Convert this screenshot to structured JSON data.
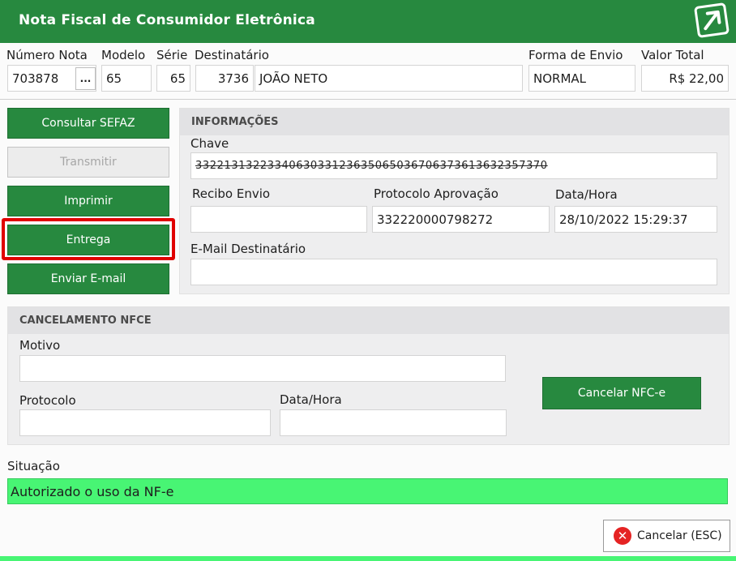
{
  "window": {
    "title": "Nota Fiscal de Consumidor Eletrônica",
    "logo_icon": "external-link-arrow-icon"
  },
  "header_fields": {
    "numero_nota": {
      "label": "Número Nota",
      "value": "703878",
      "lookup_label": "..."
    },
    "modelo": {
      "label": "Modelo",
      "value": "65"
    },
    "serie": {
      "label": "Série",
      "value": "65"
    },
    "destinatario": {
      "label": "Destinatário",
      "code": "3736",
      "name": "JOÃO NETO"
    },
    "forma_envio": {
      "label": "Forma de Envio",
      "value": "NORMAL"
    },
    "valor_total": {
      "label": "Valor Total",
      "value": "R$ 22,00"
    }
  },
  "actions": [
    {
      "label": "Consultar SEFAZ",
      "enabled": true
    },
    {
      "label": "Transmitir",
      "enabled": false
    },
    {
      "label": "Imprimir",
      "enabled": true
    },
    {
      "label": "Entrega",
      "enabled": true,
      "highlighted": true
    },
    {
      "label": "Enviar E-mail",
      "enabled": true
    }
  ],
  "informacoes": {
    "heading": "INFORMAÇÕES",
    "chave_label": "Chave",
    "chave_value": "3322131322334063033123635065036706373613632357370",
    "recibo_label": "Recibo Envio",
    "recibo_value": "",
    "protocolo_label": "Protocolo Aprovação",
    "protocolo_value": "332220000798272",
    "datahora_label": "Data/Hora",
    "datahora_value": "28/10/2022 15:29:37",
    "email_label": "E-Mail Destinatário",
    "email_value": ""
  },
  "cancelamento": {
    "heading": "CANCELAMENTO NFCE",
    "motivo_label": "Motivo",
    "motivo_value": "",
    "protocolo_label": "Protocolo",
    "protocolo_value": "",
    "datahora_label": "Data/Hora",
    "datahora_value": "",
    "cancel_button_label": "Cancelar NFC-e"
  },
  "situacao": {
    "label": "Situação",
    "value": "Autorizado o uso da NF-e",
    "color": "#48f574"
  },
  "footer": {
    "cancel_label": "Cancelar (ESC)",
    "cancel_icon": "close-circle-icon"
  },
  "colors": {
    "primary_green": "#27893f",
    "success_green": "#48f574",
    "highlight_red": "#e00000"
  }
}
